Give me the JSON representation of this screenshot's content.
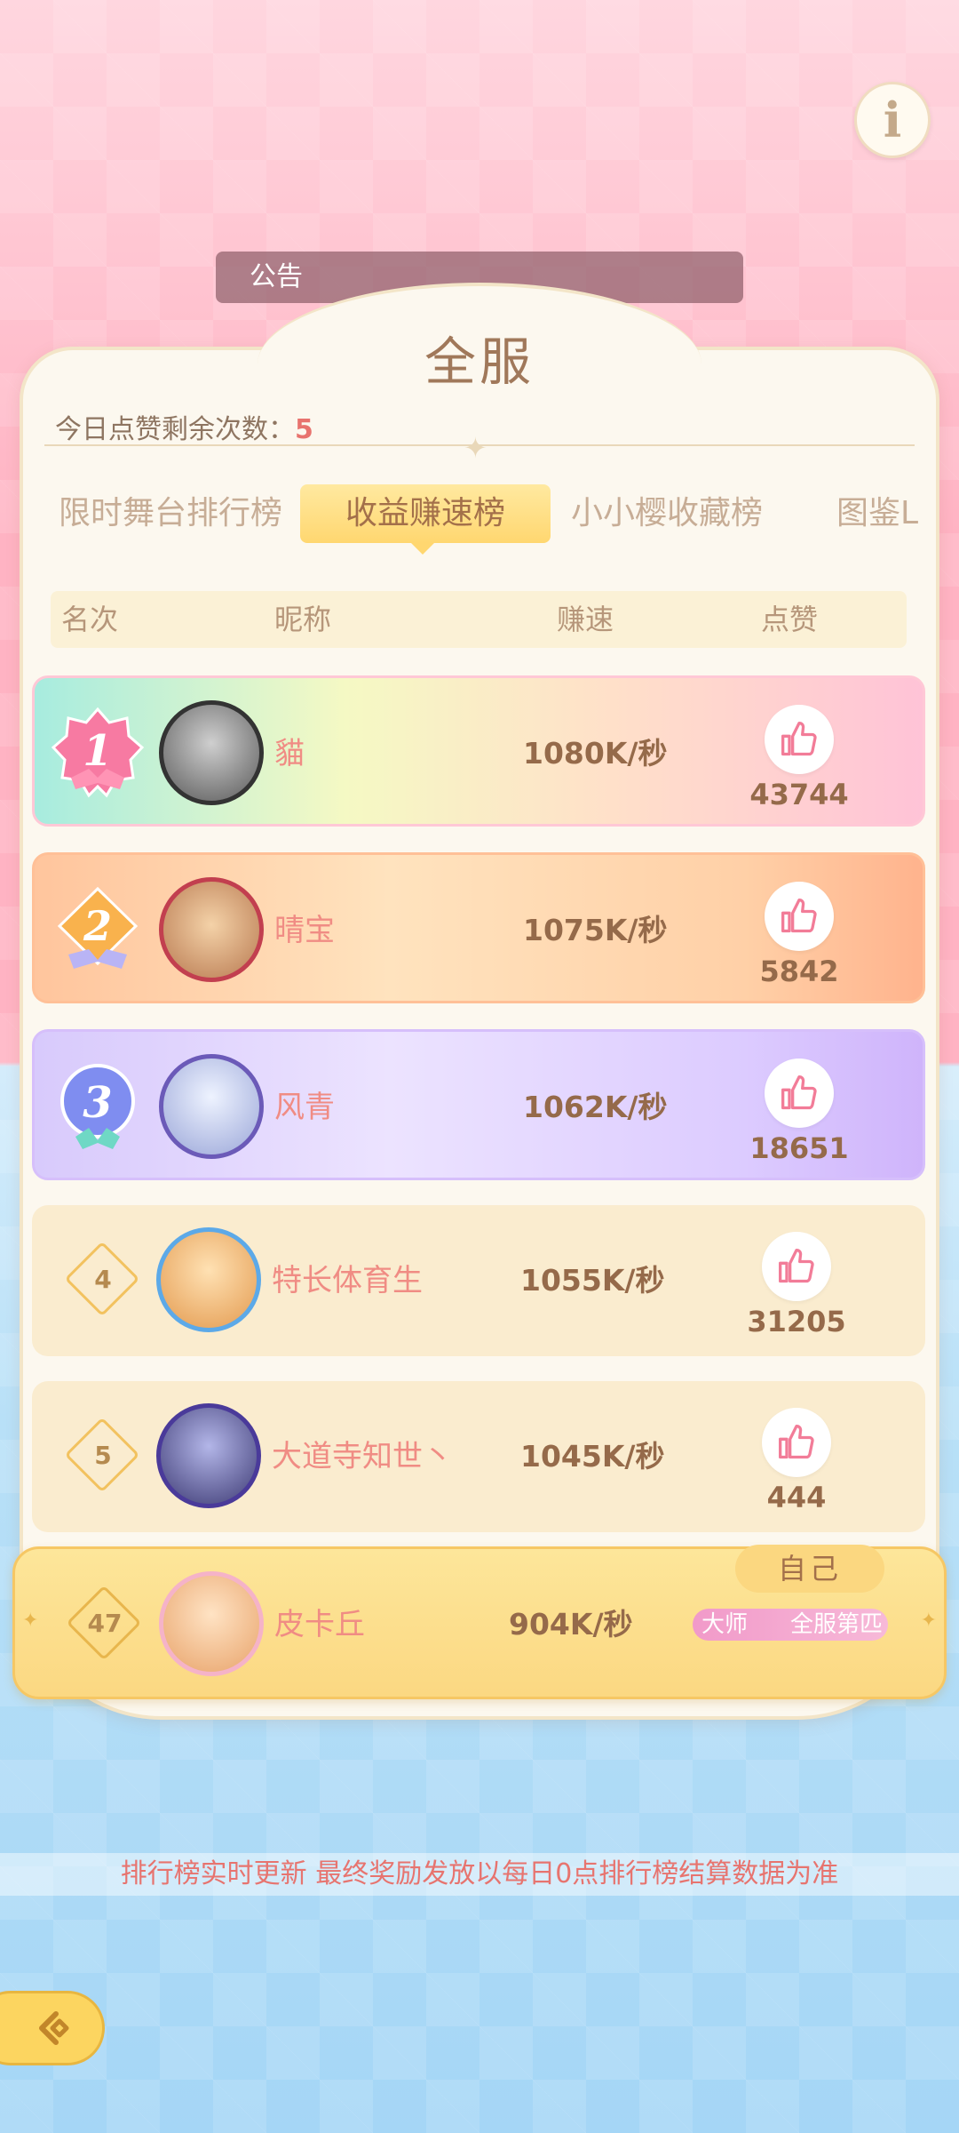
{
  "header": {
    "notice_label": "公告",
    "panel_title": "全服",
    "likes_remaining_label": "今日点赞剩余次数：",
    "likes_remaining_value": "5"
  },
  "tabs": [
    {
      "label": "限时舞台排行榜",
      "active": false
    },
    {
      "label": "收益赚速榜",
      "active": true
    },
    {
      "label": "小小樱收藏榜",
      "active": false
    },
    {
      "label": "图鉴L",
      "active": false
    }
  ],
  "columns": {
    "rank": "名次",
    "nickname": "昵称",
    "speed": "赚速",
    "likes": "点赞"
  },
  "rows": [
    {
      "rank": "1",
      "name": "貓",
      "speed": "1080K/秒",
      "likes": "43744"
    },
    {
      "rank": "2",
      "name": "晴宝",
      "speed": "1075K/秒",
      "likes": "5842"
    },
    {
      "rank": "3",
      "name": "风青",
      "speed": "1062K/秒",
      "likes": "18651"
    },
    {
      "rank": "4",
      "name": "特长体育生",
      "speed": "1055K/秒",
      "likes": "31205"
    },
    {
      "rank": "5",
      "name": "大道寺知世丶",
      "speed": "1045K/秒",
      "likes": "444"
    }
  ],
  "self": {
    "tag": "自己",
    "rank": "47",
    "name": "皮卡丘",
    "speed": "904K/秒",
    "title_a": "大师",
    "title_b": "全服第匹"
  },
  "footer": {
    "text": "排行榜实时更新 最终奖励发放以每日0点排行榜结算数据为准"
  },
  "colors": {
    "accent_gold": "#ffd770",
    "name_pink": "#f08c84",
    "speed_brown": "#956a4a"
  }
}
